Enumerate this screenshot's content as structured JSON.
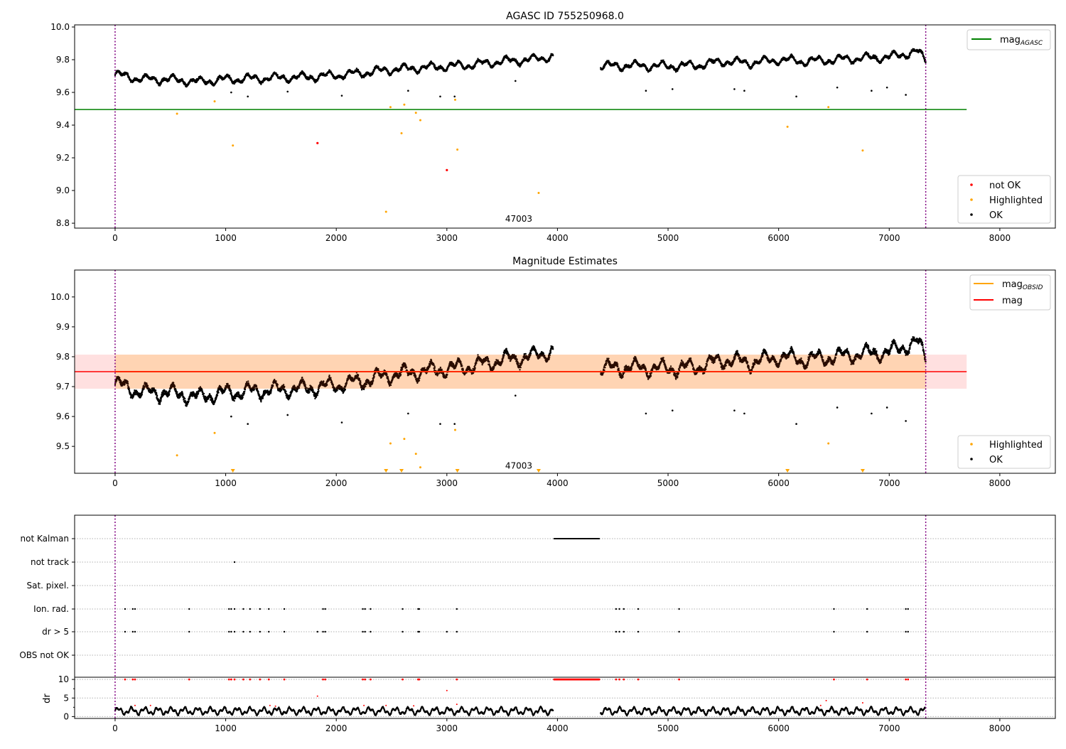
{
  "chart_data": [
    {
      "type": "scatter",
      "title": "AGASC ID 755250968.0",
      "xlim": [
        -366,
        8502
      ],
      "ylim": [
        8.77,
        10.013
      ],
      "xticks": [
        0,
        1000,
        2000,
        3000,
        4000,
        5000,
        6000,
        7000,
        8000
      ],
      "yticks": [
        8.8,
        9.0,
        9.2,
        9.4,
        9.6,
        9.8,
        10.0
      ],
      "annotation": {
        "text": "47003",
        "x": 3650,
        "y": 8.8
      },
      "vlines": [
        0,
        7330
      ],
      "mag_agasc": {
        "name": "mag_AGASC",
        "value": 9.495,
        "x": [
          -366,
          7700
        ],
        "color": "#008000"
      },
      "ok_trend": {
        "x": [
          0,
          250,
          500,
          750,
          1000,
          1250,
          1500,
          1750,
          2000,
          2250,
          2500,
          2750,
          3000,
          3250,
          3500,
          3750,
          3950,
          4400,
          4650,
          5000,
          5250,
          5500,
          5750,
          6000,
          6250,
          6500,
          6750,
          7000,
          7250,
          7330
        ],
        "y": [
          9.71,
          9.68,
          9.68,
          9.665,
          9.68,
          9.685,
          9.69,
          9.695,
          9.705,
          9.72,
          9.74,
          9.75,
          9.76,
          9.77,
          9.79,
          9.8,
          9.82,
          9.76,
          9.765,
          9.76,
          9.765,
          9.79,
          9.78,
          9.8,
          9.79,
          9.8,
          9.81,
          9.815,
          9.85,
          9.8
        ]
      },
      "ok_outliers": [
        [
          1050,
          9.6
        ],
        [
          1200,
          9.575
        ],
        [
          1560,
          9.605
        ],
        [
          2050,
          9.58
        ],
        [
          2650,
          9.61
        ],
        [
          2940,
          9.575
        ],
        [
          3070,
          9.575
        ],
        [
          3620,
          9.67
        ],
        [
          4800,
          9.61
        ],
        [
          5040,
          9.62
        ],
        [
          5600,
          9.62
        ],
        [
          5690,
          9.61
        ],
        [
          6160,
          9.575
        ],
        [
          6530,
          9.63
        ],
        [
          6840,
          9.61
        ],
        [
          6980,
          9.63
        ],
        [
          7150,
          9.585
        ]
      ],
      "highlighted": [
        [
          560,
          9.47
        ],
        [
          900,
          9.545
        ],
        [
          1065,
          9.275
        ],
        [
          2450,
          8.87
        ],
        [
          2490,
          9.51
        ],
        [
          2590,
          9.35
        ],
        [
          2615,
          9.525
        ],
        [
          2720,
          9.475
        ],
        [
          2760,
          9.43
        ],
        [
          3075,
          9.555
        ],
        [
          3095,
          9.25
        ],
        [
          3830,
          8.985
        ],
        [
          6080,
          9.39
        ],
        [
          6450,
          9.51
        ],
        [
          6760,
          9.245
        ]
      ],
      "not_ok": [
        [
          1830,
          9.29
        ],
        [
          3000,
          9.125
        ]
      ],
      "legend": [
        {
          "label": "not OK",
          "color": "#ff0000"
        },
        {
          "label": "Highlighted",
          "color": "#ffa500"
        },
        {
          "label": "OK",
          "color": "#000000"
        }
      ],
      "legend_placement": "lower-right"
    },
    {
      "type": "scatter",
      "title": "Magnitude Estimates",
      "xlim": [
        -366,
        8502
      ],
      "ylim": [
        9.41,
        10.09
      ],
      "xticks": [
        0,
        1000,
        2000,
        3000,
        4000,
        5000,
        6000,
        7000,
        8000
      ],
      "yticks": [
        9.5,
        9.6,
        9.7,
        9.8,
        9.9,
        10.0
      ],
      "annotation": {
        "text": "47003",
        "x": 3650,
        "y": 9.43
      },
      "mag_obsid": {
        "name": "mag_OBSID",
        "value": 9.75,
        "band": [
          9.693,
          9.807
        ],
        "x": [
          0,
          7330
        ],
        "color": "#ffa500"
      },
      "mag": {
        "name": "mag",
        "value": 9.75,
        "band": [
          9.693,
          9.807
        ],
        "x": [
          -366,
          7700
        ],
        "color": "#ff0000"
      },
      "below_range_highlighted_x": [
        1065,
        2450,
        2590,
        3095,
        3830,
        6080,
        6760
      ],
      "legend": [
        {
          "label": "Highlighted",
          "color": "#ffa500"
        },
        {
          "label": "OK",
          "color": "#000000"
        }
      ],
      "legend_lines": [
        {
          "label": "mag",
          "sub": "OBSID",
          "color": "#ffa500"
        },
        {
          "label": "mag",
          "sub": "",
          "color": "#ff0000"
        }
      ]
    },
    {
      "type": "scatter",
      "xlim": [
        -366,
        8502
      ],
      "xticks": [
        0,
        1000,
        2000,
        3000,
        4000,
        5000,
        6000,
        7000,
        8000
      ],
      "flag_labels": [
        "not Kalman",
        "not track",
        "Sat. pixel.",
        "Ion. rad.",
        "dr > 5",
        "OBS not OK"
      ],
      "not_kalman_range": [
        3970,
        4380
      ],
      "not_track_x": [
        1080
      ],
      "ion_rad_x": [
        90,
        160,
        180,
        670,
        1030,
        1050,
        1080,
        1160,
        1220,
        1310,
        1390,
        1530,
        1880,
        1900,
        2240,
        2260,
        2310,
        2600,
        2740,
        2750,
        3090,
        4530,
        4560,
        4600,
        4730,
        5100,
        6500,
        6800,
        7150,
        7170
      ],
      "dr5_extra_x": [
        1830,
        3000
      ],
      "dr_label": "dr",
      "dr_yticks": [
        0,
        5,
        10
      ],
      "dr_ylim": [
        -0.5,
        10.6
      ],
      "dr_mean": 1.5,
      "dr_outliers": [
        [
          180,
          3
        ],
        [
          320,
          3
        ],
        [
          1400,
          3
        ],
        [
          1450,
          2.8
        ],
        [
          1830,
          5.5
        ],
        [
          2250,
          3
        ],
        [
          2450,
          3
        ],
        [
          2700,
          2.9
        ],
        [
          3000,
          7
        ],
        [
          3090,
          3.3
        ],
        [
          6380,
          3
        ],
        [
          6430,
          4.3
        ],
        [
          6760,
          3.7
        ]
      ]
    }
  ]
}
